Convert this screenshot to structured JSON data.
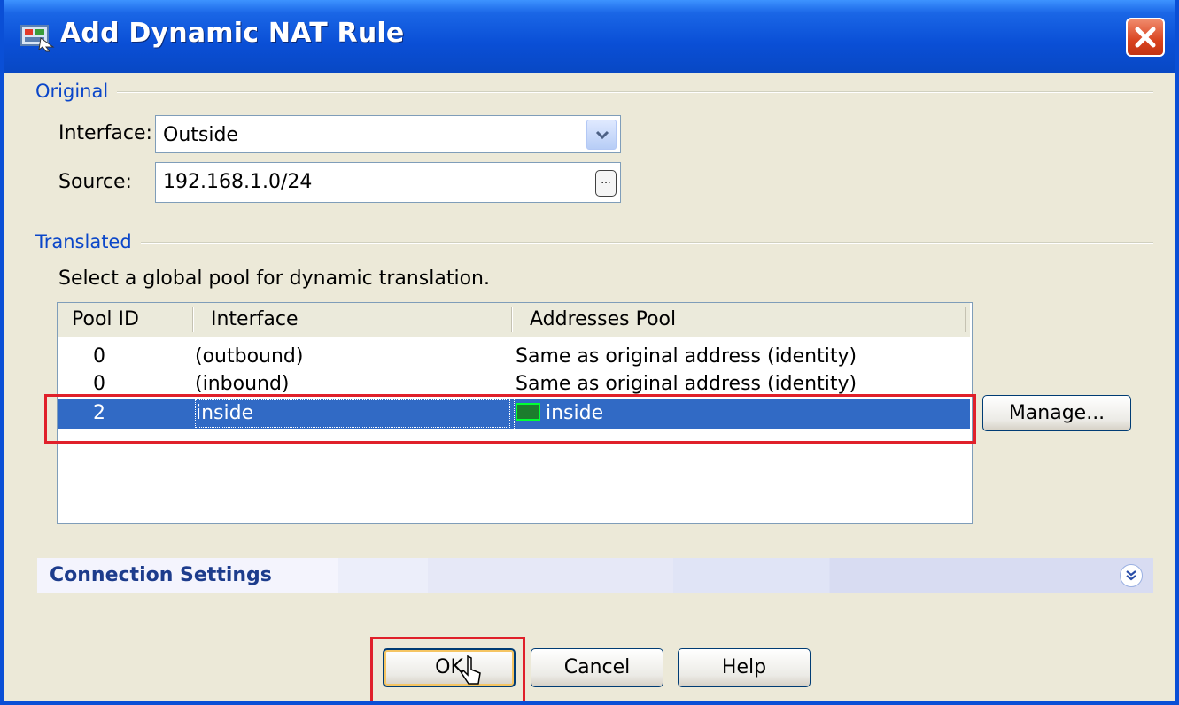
{
  "window": {
    "title": "Add Dynamic NAT Rule"
  },
  "original": {
    "group_title": "Original",
    "interface_label": "Interface:",
    "interface_value": "Outside",
    "source_label": "Source:",
    "source_value": "192.168.1.0/24",
    "browse_label": "..."
  },
  "translated": {
    "group_title": "Translated",
    "description": "Select a global pool for dynamic translation.",
    "columns": [
      "Pool ID",
      "Interface",
      "Addresses Pool"
    ],
    "rows": [
      {
        "pool_id": "0",
        "interface": "(outbound)",
        "addresses_pool": "Same as original address (identity)",
        "selected": false
      },
      {
        "pool_id": "0",
        "interface": "(inbound)",
        "addresses_pool": "Same as original address (identity)",
        "selected": false
      },
      {
        "pool_id": "2",
        "interface": "inside",
        "addresses_pool": "inside",
        "selected": true
      }
    ],
    "manage_label": "Manage..."
  },
  "connection_settings": {
    "title": "Connection Settings"
  },
  "buttons": {
    "ok": "OK",
    "cancel": "Cancel",
    "help": "Help"
  },
  "colors": {
    "selection": "#316ac5",
    "highlight": "#e0202a",
    "titlebar": "#0a4fd6",
    "group_title": "#0a46c9"
  }
}
